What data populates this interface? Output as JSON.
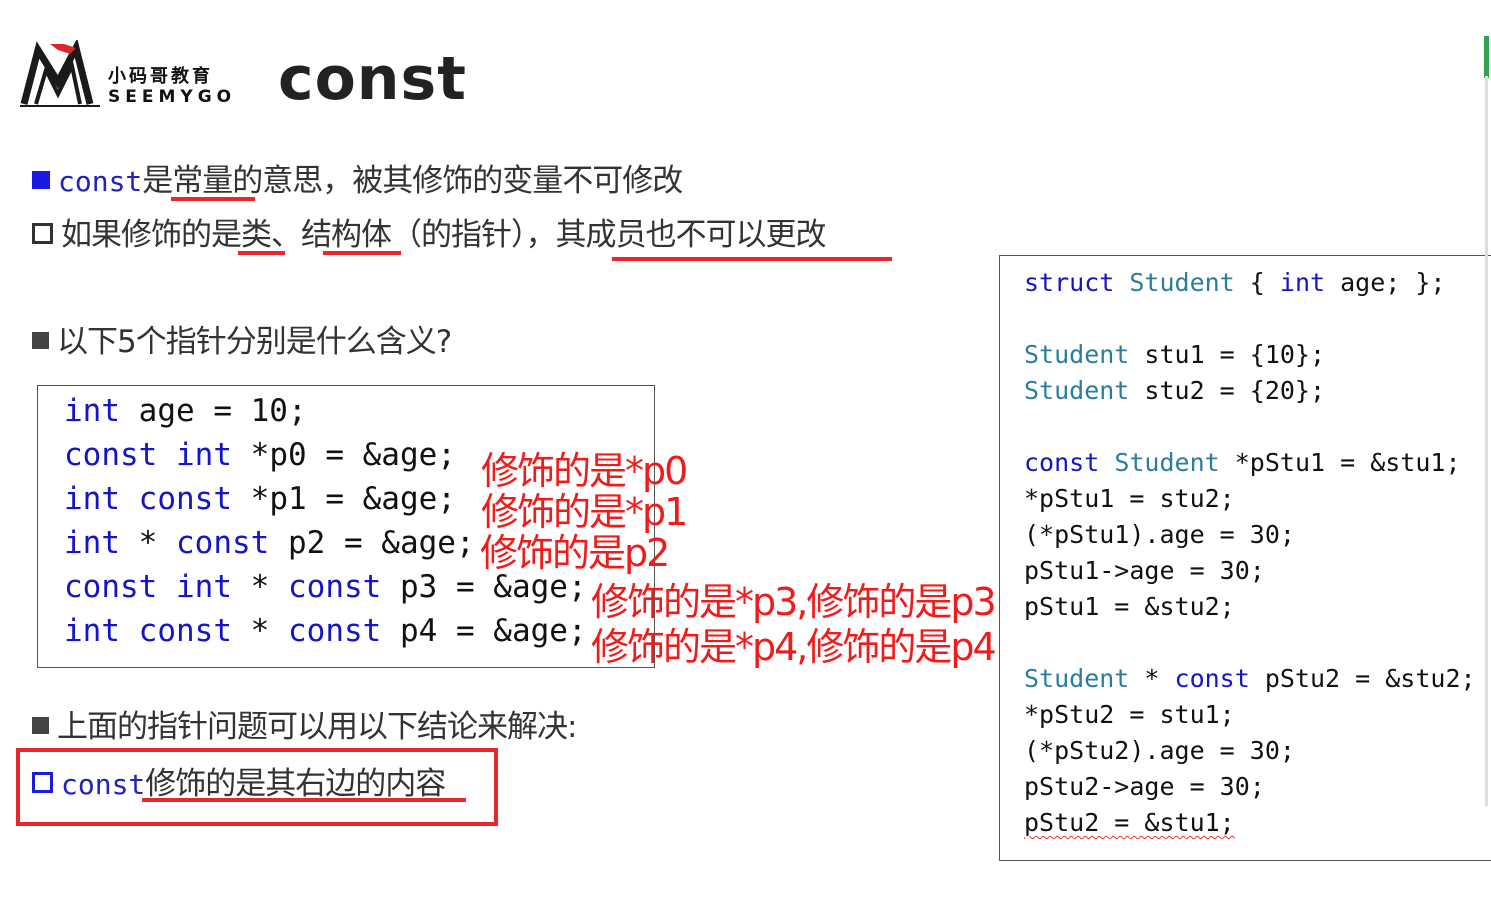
{
  "logo": {
    "cn": "小码哥教育",
    "en": "SEEMYGO"
  },
  "title": "const",
  "bullets": {
    "b1_code": "const",
    "b1_text": "是常量的意思，被其修饰的变量不可修改",
    "b2_text": "如果修饰的是类、结构体（的指针），其成员也不可以更改",
    "b3_text": "以下5个指针分别是什么含义?",
    "b4_text": "上面的指针问题可以用以下结论来解决:",
    "b5_code": "const",
    "b5_text": "修饰的是其右边的内容"
  },
  "left_code": [
    {
      "kw1": "int",
      "rest": " age = 10;"
    },
    {
      "kw1": "const",
      "kw2": "int",
      "rest": " *p0 = &age;"
    },
    {
      "kw1": "int",
      "kw2": "const",
      "rest": " *p1 = &age;"
    },
    {
      "kw1": "int",
      "mid": " * ",
      "kw2": "const",
      "rest": " p2 = &age;"
    },
    {
      "kw1": "const",
      "kw2": "int",
      "mid2": " * ",
      "kw3": "const",
      "rest": " p3 = &age;"
    },
    {
      "kw1": "int",
      "kw2": "const",
      "mid2": " * ",
      "kw3": "const",
      "rest": " p4 = &age;"
    }
  ],
  "annotations": [
    "修饰的是*p0",
    "修饰的是*p1",
    "修饰的是p2",
    "修饰的是*p3,修饰的是p3",
    "修饰的是*p4,修饰的是p4"
  ],
  "right_code": {
    "l1_kw": "struct",
    "l1_ty": "Student",
    "l1_brace": " { ",
    "l1_int": "int",
    "l1_rest": " age; };",
    "l2_ty": "Student",
    "l2_rest": " stu1 = {10};",
    "l3_ty": "Student",
    "l3_rest": " stu2 = {20};",
    "l4_kw": "const",
    "l4_ty": "Student",
    "l4_rest": " *pStu1 = &stu1;",
    "l5": "*pStu1 = stu2;",
    "l6": "(*pStu1).age = 30;",
    "l7": "pStu1->age = 30;",
    "l8": "pStu1 = &stu2;",
    "l9_ty": "Student",
    "l9_mid": " * ",
    "l9_kw": "const",
    "l9_rest": " pStu2 = &stu2;",
    "l10": "*pStu2 = stu1;",
    "l11": "(*pStu2).age = 30;",
    "l12": "pStu2->age = 30;",
    "l13": "pStu2 = &stu1;"
  },
  "colors": {
    "keyword": "#1515c8",
    "type": "#2b7d9e",
    "annotation": "#f21b1b",
    "highlight": "#e8262b"
  }
}
